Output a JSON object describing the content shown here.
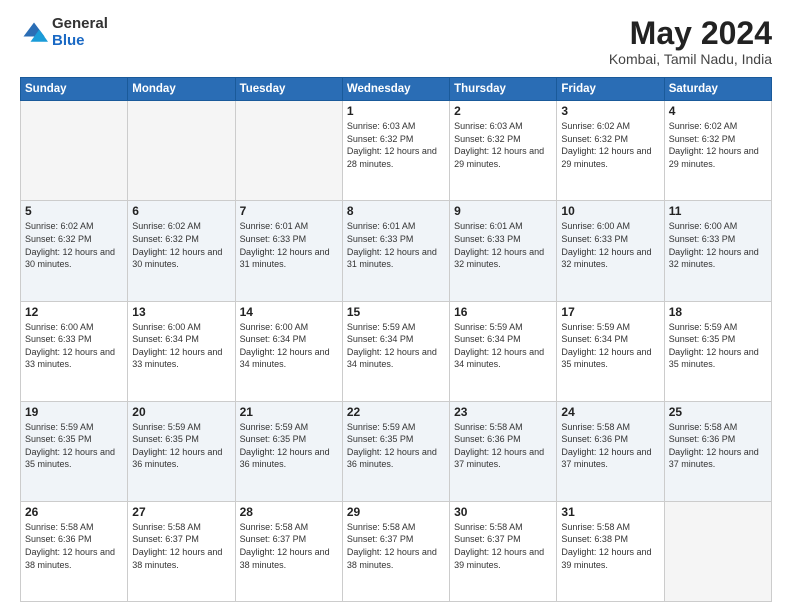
{
  "logo": {
    "general": "General",
    "blue": "Blue"
  },
  "title": "May 2024",
  "subtitle": "Kombai, Tamil Nadu, India",
  "weekdays": [
    "Sunday",
    "Monday",
    "Tuesday",
    "Wednesday",
    "Thursday",
    "Friday",
    "Saturday"
  ],
  "weeks": [
    [
      {
        "day": "",
        "sunrise": "",
        "sunset": "",
        "daylight": "",
        "empty": true
      },
      {
        "day": "",
        "sunrise": "",
        "sunset": "",
        "daylight": "",
        "empty": true
      },
      {
        "day": "",
        "sunrise": "",
        "sunset": "",
        "daylight": "",
        "empty": true
      },
      {
        "day": "1",
        "sunrise": "Sunrise: 6:03 AM",
        "sunset": "Sunset: 6:32 PM",
        "daylight": "Daylight: 12 hours and 28 minutes."
      },
      {
        "day": "2",
        "sunrise": "Sunrise: 6:03 AM",
        "sunset": "Sunset: 6:32 PM",
        "daylight": "Daylight: 12 hours and 29 minutes."
      },
      {
        "day": "3",
        "sunrise": "Sunrise: 6:02 AM",
        "sunset": "Sunset: 6:32 PM",
        "daylight": "Daylight: 12 hours and 29 minutes."
      },
      {
        "day": "4",
        "sunrise": "Sunrise: 6:02 AM",
        "sunset": "Sunset: 6:32 PM",
        "daylight": "Daylight: 12 hours and 29 minutes."
      }
    ],
    [
      {
        "day": "5",
        "sunrise": "Sunrise: 6:02 AM",
        "sunset": "Sunset: 6:32 PM",
        "daylight": "Daylight: 12 hours and 30 minutes."
      },
      {
        "day": "6",
        "sunrise": "Sunrise: 6:02 AM",
        "sunset": "Sunset: 6:32 PM",
        "daylight": "Daylight: 12 hours and 30 minutes."
      },
      {
        "day": "7",
        "sunrise": "Sunrise: 6:01 AM",
        "sunset": "Sunset: 6:33 PM",
        "daylight": "Daylight: 12 hours and 31 minutes."
      },
      {
        "day": "8",
        "sunrise": "Sunrise: 6:01 AM",
        "sunset": "Sunset: 6:33 PM",
        "daylight": "Daylight: 12 hours and 31 minutes."
      },
      {
        "day": "9",
        "sunrise": "Sunrise: 6:01 AM",
        "sunset": "Sunset: 6:33 PM",
        "daylight": "Daylight: 12 hours and 32 minutes."
      },
      {
        "day": "10",
        "sunrise": "Sunrise: 6:00 AM",
        "sunset": "Sunset: 6:33 PM",
        "daylight": "Daylight: 12 hours and 32 minutes."
      },
      {
        "day": "11",
        "sunrise": "Sunrise: 6:00 AM",
        "sunset": "Sunset: 6:33 PM",
        "daylight": "Daylight: 12 hours and 32 minutes."
      }
    ],
    [
      {
        "day": "12",
        "sunrise": "Sunrise: 6:00 AM",
        "sunset": "Sunset: 6:33 PM",
        "daylight": "Daylight: 12 hours and 33 minutes."
      },
      {
        "day": "13",
        "sunrise": "Sunrise: 6:00 AM",
        "sunset": "Sunset: 6:34 PM",
        "daylight": "Daylight: 12 hours and 33 minutes."
      },
      {
        "day": "14",
        "sunrise": "Sunrise: 6:00 AM",
        "sunset": "Sunset: 6:34 PM",
        "daylight": "Daylight: 12 hours and 34 minutes."
      },
      {
        "day": "15",
        "sunrise": "Sunrise: 5:59 AM",
        "sunset": "Sunset: 6:34 PM",
        "daylight": "Daylight: 12 hours and 34 minutes."
      },
      {
        "day": "16",
        "sunrise": "Sunrise: 5:59 AM",
        "sunset": "Sunset: 6:34 PM",
        "daylight": "Daylight: 12 hours and 34 minutes."
      },
      {
        "day": "17",
        "sunrise": "Sunrise: 5:59 AM",
        "sunset": "Sunset: 6:34 PM",
        "daylight": "Daylight: 12 hours and 35 minutes."
      },
      {
        "day": "18",
        "sunrise": "Sunrise: 5:59 AM",
        "sunset": "Sunset: 6:35 PM",
        "daylight": "Daylight: 12 hours and 35 minutes."
      }
    ],
    [
      {
        "day": "19",
        "sunrise": "Sunrise: 5:59 AM",
        "sunset": "Sunset: 6:35 PM",
        "daylight": "Daylight: 12 hours and 35 minutes."
      },
      {
        "day": "20",
        "sunrise": "Sunrise: 5:59 AM",
        "sunset": "Sunset: 6:35 PM",
        "daylight": "Daylight: 12 hours and 36 minutes."
      },
      {
        "day": "21",
        "sunrise": "Sunrise: 5:59 AM",
        "sunset": "Sunset: 6:35 PM",
        "daylight": "Daylight: 12 hours and 36 minutes."
      },
      {
        "day": "22",
        "sunrise": "Sunrise: 5:59 AM",
        "sunset": "Sunset: 6:35 PM",
        "daylight": "Daylight: 12 hours and 36 minutes."
      },
      {
        "day": "23",
        "sunrise": "Sunrise: 5:58 AM",
        "sunset": "Sunset: 6:36 PM",
        "daylight": "Daylight: 12 hours and 37 minutes."
      },
      {
        "day": "24",
        "sunrise": "Sunrise: 5:58 AM",
        "sunset": "Sunset: 6:36 PM",
        "daylight": "Daylight: 12 hours and 37 minutes."
      },
      {
        "day": "25",
        "sunrise": "Sunrise: 5:58 AM",
        "sunset": "Sunset: 6:36 PM",
        "daylight": "Daylight: 12 hours and 37 minutes."
      }
    ],
    [
      {
        "day": "26",
        "sunrise": "Sunrise: 5:58 AM",
        "sunset": "Sunset: 6:36 PM",
        "daylight": "Daylight: 12 hours and 38 minutes."
      },
      {
        "day": "27",
        "sunrise": "Sunrise: 5:58 AM",
        "sunset": "Sunset: 6:37 PM",
        "daylight": "Daylight: 12 hours and 38 minutes."
      },
      {
        "day": "28",
        "sunrise": "Sunrise: 5:58 AM",
        "sunset": "Sunset: 6:37 PM",
        "daylight": "Daylight: 12 hours and 38 minutes."
      },
      {
        "day": "29",
        "sunrise": "Sunrise: 5:58 AM",
        "sunset": "Sunset: 6:37 PM",
        "daylight": "Daylight: 12 hours and 38 minutes."
      },
      {
        "day": "30",
        "sunrise": "Sunrise: 5:58 AM",
        "sunset": "Sunset: 6:37 PM",
        "daylight": "Daylight: 12 hours and 39 minutes."
      },
      {
        "day": "31",
        "sunrise": "Sunrise: 5:58 AM",
        "sunset": "Sunset: 6:38 PM",
        "daylight": "Daylight: 12 hours and 39 minutes."
      },
      {
        "day": "",
        "sunrise": "",
        "sunset": "",
        "daylight": "",
        "empty": true
      }
    ]
  ]
}
